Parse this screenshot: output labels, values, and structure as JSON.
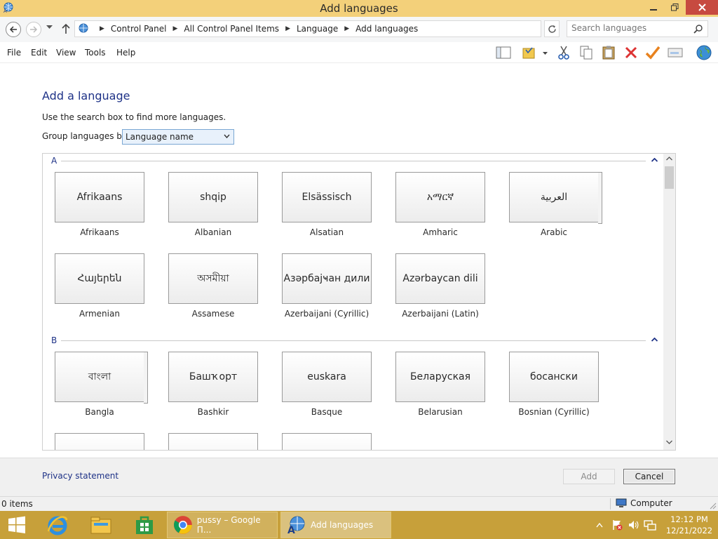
{
  "window": {
    "title": "Add languages"
  },
  "address": {
    "crumbs": [
      "Control Panel",
      "All Control Panel Items",
      "Language",
      "Add languages"
    ],
    "search_placeholder": "Search languages"
  },
  "menu": [
    "File",
    "Edit",
    "View",
    "Tools",
    "Help"
  ],
  "toolbar_icons": [
    "layout-pane-icon",
    "folder-options-icon",
    "cut-icon",
    "copy-icon",
    "paste-icon",
    "delete-icon",
    "checkmark-icon",
    "properties-icon",
    "globe-icon"
  ],
  "content": {
    "heading": "Add a language",
    "hint": "Use the search box to find more languages.",
    "group_label": "Group languages by:",
    "group_value": "Language name"
  },
  "sections": [
    {
      "letter": "A",
      "languages": [
        {
          "native": "Afrikaans",
          "name": "Afrikaans",
          "stack": false
        },
        {
          "native": "shqip",
          "name": "Albanian",
          "stack": false
        },
        {
          "native": "Elsässisch",
          "name": "Alsatian",
          "stack": false
        },
        {
          "native": "አማርኛ",
          "name": "Amharic",
          "stack": false
        },
        {
          "native": "العربية",
          "name": "Arabic",
          "stack": true
        },
        {
          "native": "Հայերեն",
          "name": "Armenian",
          "stack": false
        },
        {
          "native": "অসমীয়া",
          "name": "Assamese",
          "stack": false
        },
        {
          "native": "Азәрбајҹан дили",
          "name": "Azerbaijani (Cyrillic)",
          "stack": false
        },
        {
          "native": "Azərbaycan dili",
          "name": "Azerbaijani (Latin)",
          "stack": false
        }
      ]
    },
    {
      "letter": "B",
      "languages": [
        {
          "native": "বাংলা",
          "name": "Bangla",
          "stack": true
        },
        {
          "native": "Башҡорт",
          "name": "Bashkir",
          "stack": false
        },
        {
          "native": "euskara",
          "name": "Basque",
          "stack": false
        },
        {
          "native": "Беларуская",
          "name": "Belarusian",
          "stack": false
        },
        {
          "native": "босански",
          "name": "Bosnian (Cyrillic)",
          "stack": false
        }
      ]
    }
  ],
  "footer": {
    "privacy": "Privacy statement",
    "add_label": "Add",
    "cancel_label": "Cancel"
  },
  "status": {
    "items": "0 items",
    "computer": "Computer"
  },
  "taskbar": {
    "chrome_label": "pussy – Google П...",
    "active_label": "Add languages",
    "time": "12:12 PM",
    "date": "12/21/2022"
  },
  "colors": {
    "titlebar": "#f3d07a",
    "taskbar": "#c7a03a",
    "link": "#1e3287",
    "close": "#c74a40"
  }
}
